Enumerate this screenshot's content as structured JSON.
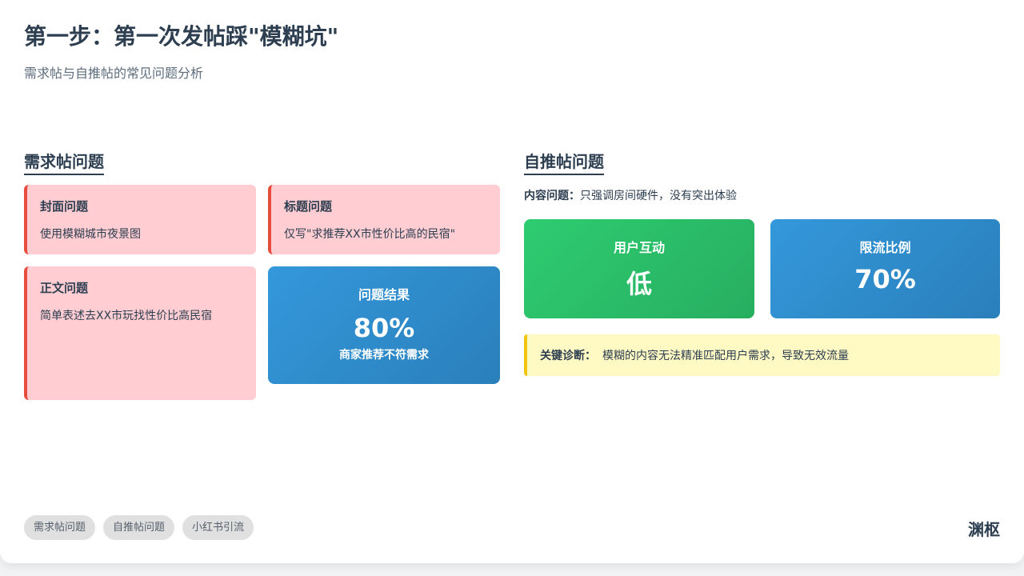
{
  "header": {
    "title": "第一步：第一次发帖踩\"模糊坑\"",
    "subtitle": "需求帖与自推帖的常见问题分析"
  },
  "demand": {
    "section_title": "需求帖问题",
    "cover": {
      "title": "封面问题",
      "text": "使用模糊城市夜景图"
    },
    "headline": {
      "title": "标题问题",
      "text": "仅写\"求推荐XX市性价比高的民宿\""
    },
    "body": {
      "title": "正文问题",
      "text": "简单表述去XX市玩找性价比高民宿"
    },
    "result": {
      "label": "问题结果",
      "value": "80%",
      "note": "商家推荐不符需求"
    }
  },
  "self_promo": {
    "section_title": "自推帖问题",
    "content_issue_label": "内容问题：",
    "content_issue_text": "只强调房间硬件，没有突出体验",
    "interaction": {
      "label": "用户互动",
      "value": "低"
    },
    "throttle": {
      "label": "限流比例",
      "value": "70%"
    },
    "diagnosis_label": "关键诊断：",
    "diagnosis_text": "模糊的内容无法精准匹配用户需求，导致无效流量"
  },
  "footer": {
    "tags": [
      "需求帖问题",
      "自推帖问题",
      "小红书引流"
    ],
    "brand": "渊枢"
  },
  "colors": {
    "problem_bg": "#ffcdd2",
    "problem_border": "#e74c3c",
    "blue": "#3498db",
    "green": "#2ecc71",
    "diagnosis_bg": "#fff9c4",
    "diagnosis_border": "#f1c40f",
    "text": "#2c3e50"
  }
}
